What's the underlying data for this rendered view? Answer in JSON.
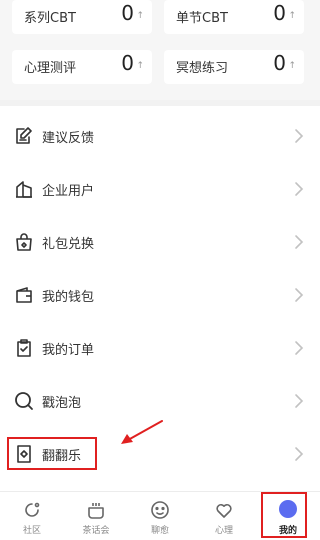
{
  "stats": [
    {
      "label": "系列CBT",
      "count": "0",
      "arrow": "↑"
    },
    {
      "label": "单节CBT",
      "count": "0",
      "arrow": "↑"
    },
    {
      "label": "心理测评",
      "count": "0",
      "arrow": "↑"
    },
    {
      "label": "冥想练习",
      "count": "0",
      "arrow": "↑"
    }
  ],
  "menu": [
    {
      "label": "建议反馈",
      "icon": "feedback-icon"
    },
    {
      "label": "企业用户",
      "icon": "building-icon"
    },
    {
      "label": "礼包兑换",
      "icon": "gift-bag-icon"
    },
    {
      "label": "我的钱包",
      "icon": "wallet-icon"
    },
    {
      "label": "我的订单",
      "icon": "order-clipboard-icon"
    },
    {
      "label": "戳泡泡",
      "icon": "bubble-icon"
    },
    {
      "label": "翻翻乐",
      "icon": "flip-card-icon"
    }
  ],
  "tabs": [
    {
      "label": "社区",
      "icon": "community-icon"
    },
    {
      "label": "茶话会",
      "icon": "tea-cup-icon"
    },
    {
      "label": "聊愈",
      "icon": "chat-face-icon"
    },
    {
      "label": "心理",
      "icon": "heart-icon"
    },
    {
      "label": "我的",
      "icon": "profile-avatar-icon",
      "active": true
    }
  ],
  "colors": {
    "accent": "#5b6cf0",
    "annotation": "#e02020",
    "background": "#f6f6f6"
  }
}
